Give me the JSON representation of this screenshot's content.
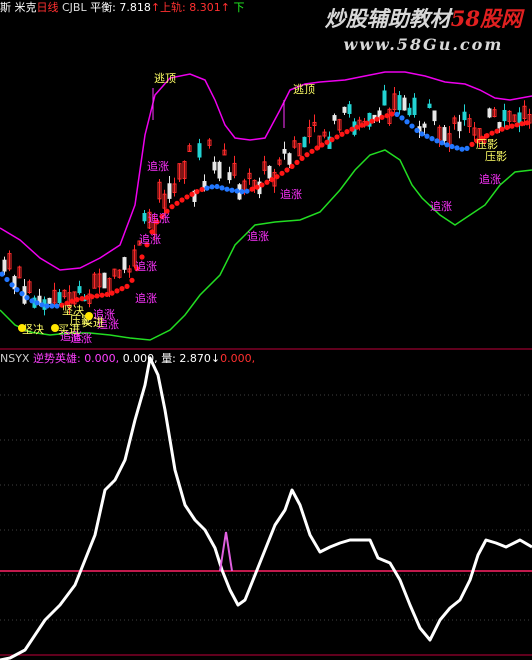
{
  "header": {
    "code": "斯",
    "name": "米克",
    "period": "日线",
    "indicator": "CJBL",
    "balance_label": "平衡:",
    "balance_value": "7.818",
    "up_arrow": "↑",
    "upper_label": "上轨:",
    "upper_value": "8.301",
    "lower_label": "下"
  },
  "sub_header": {
    "indicator": "NSYX",
    "name_label": "逆势英雄:",
    "v1": "0.000,",
    "v2": "0.000,",
    "vol_label": "量:",
    "vol_value": "2.870",
    "down_arrow": "↓",
    "v3": "0.000,"
  },
  "watermark": {
    "line1_a": "炒股辅助教材",
    "line1_b": "58股网",
    "line2": "www.58Gu.com"
  },
  "colors": {
    "upper_band": "#ee00ee",
    "lower_band": "#22dd22",
    "mid_up": "#ff1515",
    "mid_down": "#2277ff",
    "label_magenta": "#ff33ff",
    "label_yellow": "#ffff66",
    "signal_dot": "#ffe600",
    "osc_line": "#ffffff",
    "threshold_line": "#ff2266"
  },
  "main_chart": {
    "labels": [
      {
        "text": "逃顶",
        "color": "yellow"
      },
      {
        "text": "逃顶",
        "color": "yellow"
      },
      {
        "text": "追涨",
        "color": "magenta"
      },
      {
        "text": "追涨",
        "color": "magenta"
      },
      {
        "text": "追涨",
        "color": "magenta"
      },
      {
        "text": "追涨",
        "color": "magenta"
      },
      {
        "text": "追涨",
        "color": "magenta"
      },
      {
        "text": "追涨",
        "color": "magenta"
      },
      {
        "text": "追涨",
        "color": "magenta"
      },
      {
        "text": "追涨",
        "color": "magenta"
      },
      {
        "text": "追涨",
        "color": "magenta"
      },
      {
        "text": "追涨",
        "color": "magenta"
      },
      {
        "text": "追涨",
        "color": "magenta"
      },
      {
        "text": "追涨",
        "color": "magenta"
      },
      {
        "text": "压影",
        "color": "yellow"
      },
      {
        "text": "压影",
        "color": "yellow"
      },
      {
        "text": "坚决",
        "color": "yellow"
      },
      {
        "text": "买进",
        "color": "yellow"
      },
      {
        "text": "坚决",
        "color": "yellow"
      },
      {
        "text": "买进",
        "color": "yellow"
      },
      {
        "text": "压影",
        "color": "yellow"
      },
      {
        "text": "追涨",
        "color": "magenta"
      }
    ]
  }
}
